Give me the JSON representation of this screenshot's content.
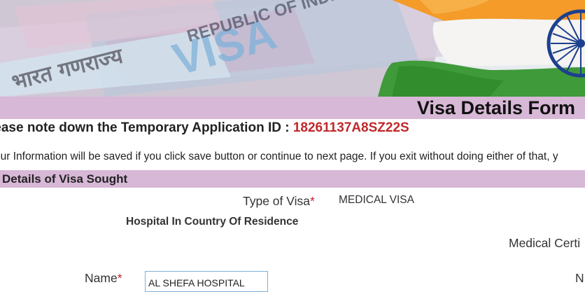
{
  "banner": {
    "visa_stamp_text": "VISA",
    "republic_text": "REPUBLIC OF INDIA",
    "hindi_text": "भारत गणराज्य"
  },
  "form": {
    "title": "Visa Details Form",
    "temp_id_label": "lease note down the Temporary Application ID :",
    "temp_id_value": "18261137A8SZ22S",
    "notice": "our Information will be saved if you click save button or continue to next page. If you exit without doing either of that, y"
  },
  "section": {
    "title": "Details of Visa Sought"
  },
  "fields": {
    "type_of_visa_label": "Type of Visa",
    "type_of_visa_value": "MEDICAL VISA",
    "hospital_heading": "Hospital In Country Of Residence",
    "medical_cert_label": "Medical Certi",
    "name_label": "Name",
    "name_value": "AL SHEFA HOSPITAL",
    "right_truncated_label": "N"
  },
  "colors": {
    "title_bar": "#d7b8d6",
    "id_red": "#c0282a",
    "input_border": "#7fb0d8"
  }
}
